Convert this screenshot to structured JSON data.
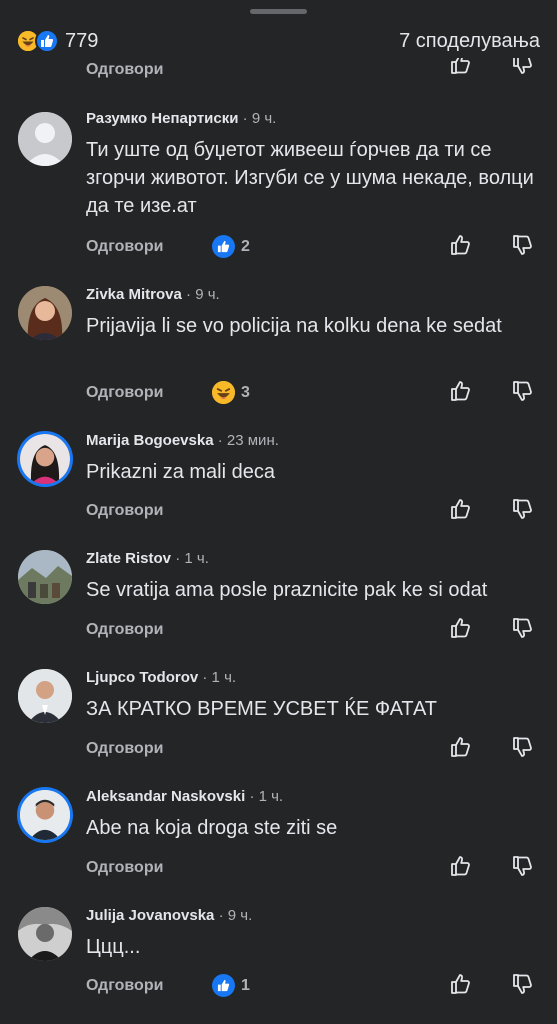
{
  "header": {
    "reaction_count": "779",
    "shares": "7 споделувања"
  },
  "reply_label": "Одговори",
  "icons": {
    "reaction_haha": "haha-emoji-icon",
    "reaction_like": "like-reaction-icon",
    "like": "thumbs-up-icon",
    "dislike": "thumbs-down-icon"
  },
  "colors": {
    "background": "#242526",
    "like_blue": "#1877f2",
    "haha_yellow": "#f7b928",
    "muted": "#b0b3b8"
  },
  "comments": [
    {
      "name": "Разумко Непартиски",
      "time": "· 9 ч.",
      "text": "Ти уште од буџетот живееш ѓорчев да ти се згорчи животот. Изгуби се у шума некаде, волци да те изе.ат",
      "reaction": "like",
      "reaction_count": "2"
    },
    {
      "name": "Zivka Mitrova",
      "time": "· 9 ч.",
      "text": "Prijavija li se vo policija na kolku dena ke sedat",
      "reaction": "haha",
      "reaction_count": "3"
    },
    {
      "name": "Marija Bogoevska",
      "time": "· 23 мин.",
      "text": "Prikazni za mali deca",
      "reaction": "",
      "reaction_count": ""
    },
    {
      "name": "Zlate Ristov",
      "time": "· 1 ч.",
      "text": "Se vratija ama posle praznicite pak ke si odat",
      "reaction": "",
      "reaction_count": ""
    },
    {
      "name": "Ljupco Todorov",
      "time": "· 1 ч.",
      "text": "ЗА КРАТКО ВРЕМЕ УСВЕТ ЌЕ ФАТАТ",
      "reaction": "",
      "reaction_count": ""
    },
    {
      "name": "Aleksandar Naskovski",
      "time": "· 1 ч.",
      "text": "Abe na koja droga ste ziti se",
      "reaction": "",
      "reaction_count": ""
    },
    {
      "name": "Julija Jovanovska",
      "time": "· 9 ч.",
      "text": "Ццц...",
      "reaction": "like",
      "reaction_count": "1"
    }
  ]
}
